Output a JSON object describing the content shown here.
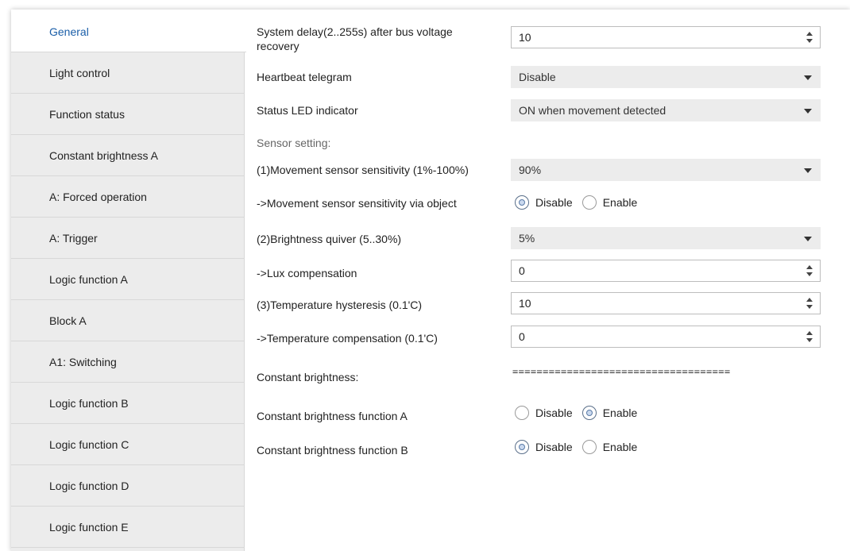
{
  "sidebar": {
    "items": [
      {
        "label": "General"
      },
      {
        "label": "Light control"
      },
      {
        "label": "Function status"
      },
      {
        "label": "Constant brightness A"
      },
      {
        "label": "A: Forced operation"
      },
      {
        "label": "A: Trigger"
      },
      {
        "label": "Logic function A"
      },
      {
        "label": "Block A"
      },
      {
        "label": "A1: Switching"
      },
      {
        "label": "Logic function B"
      },
      {
        "label": "Logic function C"
      },
      {
        "label": "Logic function D"
      },
      {
        "label": "Logic function E"
      }
    ],
    "active": "General"
  },
  "params": {
    "system_delay": {
      "label_line1": "System delay(2..255s) after bus voltage",
      "label_line2": "recovery",
      "value": "10"
    },
    "heartbeat": {
      "label": "Heartbeat telegram",
      "value": "Disable"
    },
    "status_led": {
      "label": "Status LED indicator",
      "value": "ON when movement detected"
    },
    "sensor_setting": {
      "label": "Sensor setting:"
    },
    "movement_sensitivity": {
      "label": "(1)Movement sensor sensitivity (1%-100%)",
      "value": "90%"
    },
    "movement_via_object": {
      "label": "->Movement sensor sensitivity via object",
      "options": [
        "Disable",
        "Enable"
      ],
      "selected": "Disable"
    },
    "brightness_quiver": {
      "label": "(2)Brightness quiver (5..30%)",
      "value": "5%"
    },
    "lux_compensation": {
      "label": "->Lux compensation",
      "value": "0"
    },
    "temp_hysteresis": {
      "label": "(3)Temperature hysteresis (0.1'C)",
      "value": "10"
    },
    "temp_compensation": {
      "label": "->Temperature compensation (0.1'C)",
      "value": "0"
    },
    "constant_brightness": {
      "label": "Constant brightness:",
      "separator": "===================================="
    },
    "cb_function_a": {
      "label": "Constant brightness function A",
      "options": [
        "Disable",
        "Enable"
      ],
      "selected": "Enable"
    },
    "cb_function_b": {
      "label": "Constant brightness function B",
      "options": [
        "Disable",
        "Enable"
      ],
      "selected": "Disable"
    }
  },
  "colors": {
    "active_nav": "#1a5ea8",
    "sidebar_bg": "#ececec",
    "select_bg": "#ececec"
  }
}
